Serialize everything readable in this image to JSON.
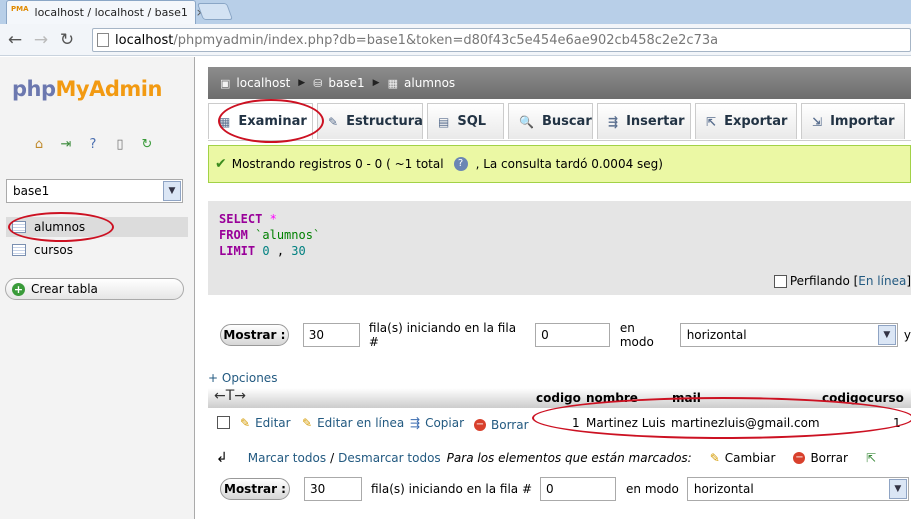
{
  "browser": {
    "tab_favicon": "PMA",
    "tab_title": "localhost / localhost / base1",
    "tab_close": "×",
    "back_icon": "←",
    "forward_icon": "→",
    "reload_icon": "↻",
    "url_host": "localhost",
    "url_path": "/phpmyadmin/index.php?db=base1&token=d80f43c5e454e6ae902cb458c2e2c73a"
  },
  "sidebar": {
    "logo_php": "php",
    "logo_myadmin": "MyAdmin",
    "icons": [
      "home-icon",
      "logout-icon",
      "help-icon",
      "docs-icon",
      "reload-icon"
    ],
    "database_select": "base1",
    "tables": [
      {
        "label": "alumnos"
      },
      {
        "label": "cursos"
      }
    ],
    "create_table": "Crear tabla"
  },
  "breadcrumb": {
    "server": "localhost",
    "database": "base1",
    "table": "alumnos"
  },
  "tabs": [
    {
      "label": "Examinar",
      "icon": "▦"
    },
    {
      "label": "Estructura",
      "icon": "✎"
    },
    {
      "label": "SQL",
      "icon": "▤"
    },
    {
      "label": "Buscar",
      "icon": "🔍"
    },
    {
      "label": "Insertar",
      "icon": "⇶"
    },
    {
      "label": "Exportar",
      "icon": "⇱"
    },
    {
      "label": "Importar",
      "icon": "⇲"
    }
  ],
  "success": {
    "text_before": "Mostrando registros 0 - 0 ( ~1 total",
    "text_after": ", La consulta tardó 0.0004 seg)"
  },
  "sql": {
    "select": "SELECT",
    "star": "*",
    "from": "FROM",
    "table": "`alumnos`",
    "limit": "LIMIT",
    "offset": "0",
    "comma": ",",
    "count": "30"
  },
  "profiling": {
    "label": "Perfilando [",
    "link": "En línea",
    "close": "]"
  },
  "nav": {
    "show_button": "Mostrar :",
    "rows_value": "30",
    "rows_label": "fila(s) iniciando en la fila #",
    "start_value": "0",
    "mode_label": "en modo",
    "mode_value": "horizontal",
    "trailing": "y"
  },
  "options_link": "+ Opciones",
  "columns": [
    "codigo",
    "nombre",
    "mail",
    "codigocurso"
  ],
  "column_arrows": "←T→",
  "rows": [
    {
      "actions": {
        "edit": "Editar",
        "inline_edit": "Editar en línea",
        "copy": "Copiar",
        "delete": "Borrar"
      },
      "codigo": "1",
      "nombre": "Martinez Luis",
      "mail": "martinezluis@gmail.com",
      "codigocurso": "1"
    }
  ],
  "bulk": {
    "check_all": "Marcar todos",
    "separator": "/",
    "uncheck_all": "Desmarcar todos",
    "with_selected": "Para los elementos que están marcados:",
    "change": "Cambiar",
    "delete": "Borrar"
  },
  "colors": {
    "annotation_red": "#cc1122",
    "success_bg": "#ebf8a4",
    "link_blue": "#235a81",
    "sql_keyword": "#990099"
  }
}
